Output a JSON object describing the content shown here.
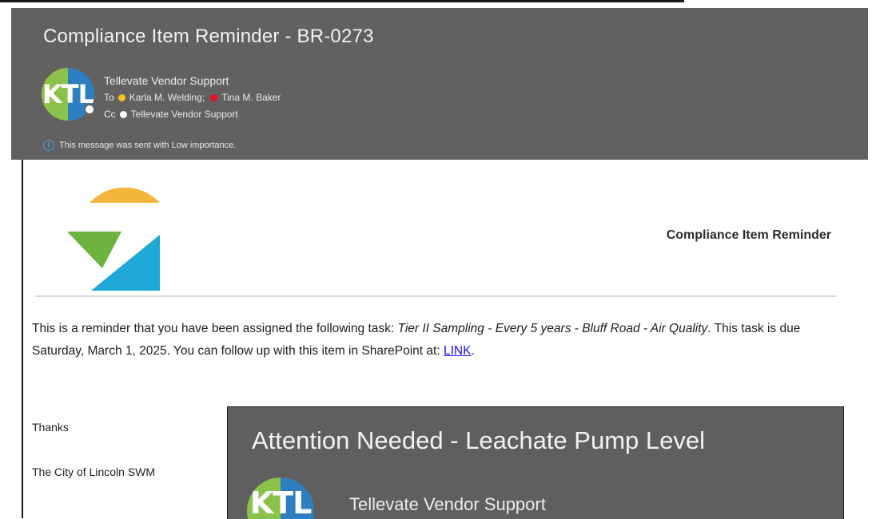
{
  "email1": {
    "subject": "Compliance Item Reminder - BR-0273",
    "avatar_initials": "KTL",
    "sender": "Tellevate Vendor Support",
    "to_label": "To",
    "recipients": [
      "Karla M. Welding;",
      "Tina M. Baker"
    ],
    "cc_label": "Cc",
    "cc_recipient": "Tellevate Vendor Support",
    "importance_notice": "This message was sent with Low importance.",
    "banner_title": "Compliance Item Reminder",
    "body": {
      "intro": "This is a reminder that you have been assigned the following task: ",
      "task_name": "Tier II Sampling - Every 5 years - Bluff Road - Air Quality",
      "due_text": ". This task is due Saturday, March 1, 2025. You can follow up with this item in SharePoint at: ",
      "link_text": "LINK",
      "end": "."
    },
    "thanks": "Thanks",
    "signoff": "The City of Lincoln SWM"
  },
  "email2": {
    "subject": "Attention Needed - Leachate Pump Level",
    "avatar_initials": "KTL",
    "sender": "Tellevate Vendor Support"
  },
  "colors": {
    "header_bg": "#616161",
    "link": "#1a0dff",
    "presence_away": "#f5c518",
    "presence_busy": "#e81123",
    "logo_yellow": "#f4b63a",
    "logo_green": "#6cb33f",
    "logo_blue": "#1fa8d8"
  }
}
